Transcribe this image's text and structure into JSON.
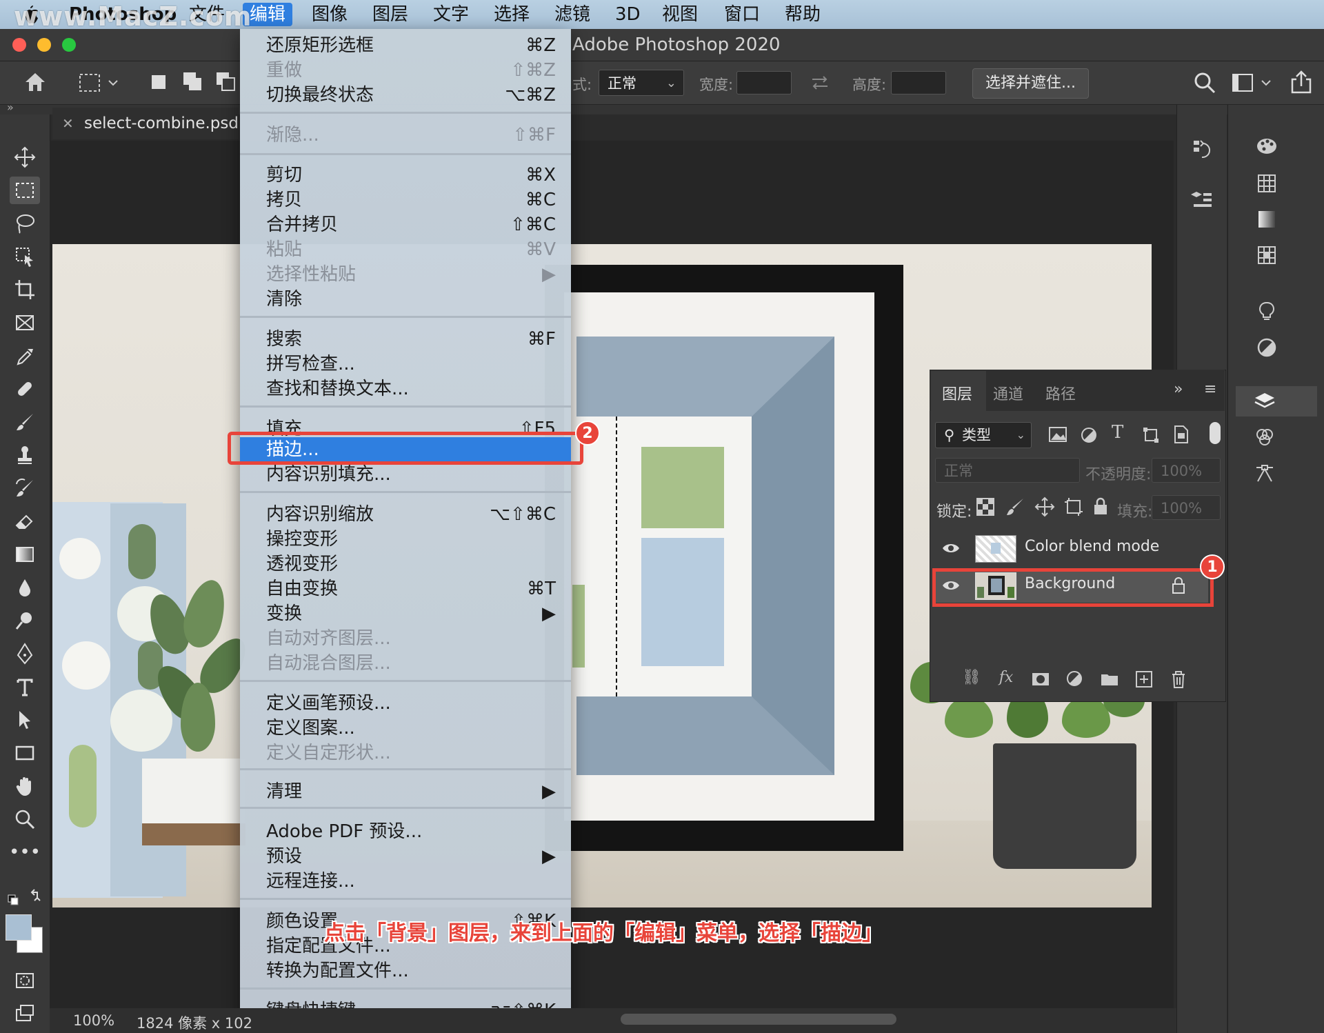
{
  "watermark": "www.MacZ.com",
  "menubar": {
    "app": "Photoshop",
    "items": [
      "文件",
      "编辑",
      "图像",
      "图层",
      "文字",
      "选择",
      "滤镜",
      "3D",
      "视图",
      "窗口",
      "帮助"
    ],
    "active": "编辑"
  },
  "window": {
    "title": "Adobe Photoshop 2020"
  },
  "options_bar": {
    "style_label": "式:",
    "style_value": "正常",
    "width_label": "宽度:",
    "height_label": "高度:",
    "select_mask_button": "选择并遮住..."
  },
  "document": {
    "tab_name": "select-combine.psd"
  },
  "edit_menu": {
    "groups": [
      [
        {
          "label": "还原矩形选框",
          "shortcut": "⌘Z",
          "disabled": false
        },
        {
          "label": "重做",
          "shortcut": "⇧⌘Z",
          "disabled": true
        },
        {
          "label": "切换最终状态",
          "shortcut": "⌥⌘Z",
          "disabled": false
        }
      ],
      [
        {
          "label": "渐隐...",
          "shortcut": "⇧⌘F",
          "disabled": true
        }
      ],
      [
        {
          "label": "剪切",
          "shortcut": "⌘X",
          "disabled": false
        },
        {
          "label": "拷贝",
          "shortcut": "⌘C",
          "disabled": false
        },
        {
          "label": "合并拷贝",
          "shortcut": "⇧⌘C",
          "disabled": false
        },
        {
          "label": "粘贴",
          "shortcut": "⌘V",
          "disabled": true
        },
        {
          "label": "选择性粘贴",
          "shortcut": "▶",
          "disabled": true
        },
        {
          "label": "清除",
          "shortcut": "",
          "disabled": false
        }
      ],
      [
        {
          "label": "搜索",
          "shortcut": "⌘F",
          "disabled": false
        },
        {
          "label": "拼写检查...",
          "shortcut": "",
          "disabled": false
        },
        {
          "label": "查找和替换文本...",
          "shortcut": "",
          "disabled": false
        }
      ],
      [
        {
          "label": "填充...",
          "shortcut": "⇧F5",
          "disabled": false
        },
        {
          "label": "描边...",
          "shortcut": "",
          "disabled": false,
          "highlight": true
        },
        {
          "label": "内容识别填充...",
          "shortcut": "",
          "disabled": false
        }
      ],
      [
        {
          "label": "内容识别缩放",
          "shortcut": "⌥⇧⌘C",
          "disabled": false
        },
        {
          "label": "操控变形",
          "shortcut": "",
          "disabled": false
        },
        {
          "label": "透视变形",
          "shortcut": "",
          "disabled": false
        },
        {
          "label": "自由变换",
          "shortcut": "⌘T",
          "disabled": false
        },
        {
          "label": "变换",
          "shortcut": "▶",
          "disabled": false
        },
        {
          "label": "自动对齐图层...",
          "shortcut": "",
          "disabled": true
        },
        {
          "label": "自动混合图层...",
          "shortcut": "",
          "disabled": true
        }
      ],
      [
        {
          "label": "定义画笔预设...",
          "shortcut": "",
          "disabled": false
        },
        {
          "label": "定义图案...",
          "shortcut": "",
          "disabled": false
        },
        {
          "label": "定义自定形状...",
          "shortcut": "",
          "disabled": true
        }
      ],
      [
        {
          "label": "清理",
          "shortcut": "▶",
          "disabled": false
        }
      ],
      [
        {
          "label": "Adobe PDF 预设...",
          "shortcut": "",
          "disabled": false
        },
        {
          "label": "预设",
          "shortcut": "▶",
          "disabled": false
        },
        {
          "label": "远程连接...",
          "shortcut": "",
          "disabled": false
        }
      ],
      [
        {
          "label": "颜色设置...",
          "shortcut": "⇧⌘K",
          "disabled": false
        },
        {
          "label": "指定配置文件...",
          "shortcut": "",
          "disabled": false
        },
        {
          "label": "转换为配置文件...",
          "shortcut": "",
          "disabled": false
        }
      ],
      [
        {
          "label": "键盘快捷键...",
          "shortcut": "⌥⇧⌘K",
          "disabled": false
        }
      ]
    ]
  },
  "layers_panel": {
    "tabs": [
      "图层",
      "通道",
      "路径"
    ],
    "active_tab": "图层",
    "filter_label": "类型",
    "blend_mode": "正常",
    "opacity_label": "不透明度:",
    "opacity_value": "100%",
    "lock_label": "锁定:",
    "fill_label": "填充:",
    "fill_value": "100%",
    "layers": [
      {
        "name": "Color blend mode",
        "visible": true,
        "locked": false
      },
      {
        "name": "Background",
        "visible": true,
        "locked": true,
        "selected": true
      }
    ]
  },
  "annotations": {
    "badge_1": "1",
    "badge_2": "2",
    "caption": "点击「背景」图层，来到上面的「编辑」菜单，选择「描边」"
  },
  "statusbar": {
    "zoom": "100%",
    "doc_info": "1824 像素 x 102"
  },
  "colors": {
    "highlight_blue": "#2f7fe0",
    "annotation_red": "#e8443a",
    "panel_bg": "#3b3b3b"
  }
}
